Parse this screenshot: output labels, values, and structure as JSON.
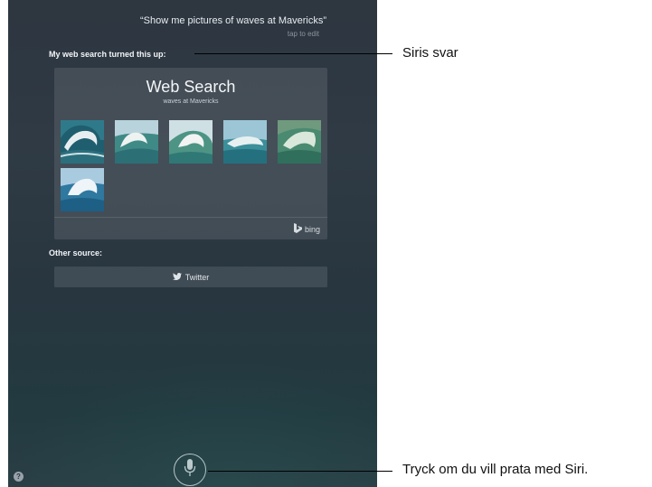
{
  "siri": {
    "query": "“Show me pictures of waves at Mavericks”",
    "tap_to_edit": "tap to edit",
    "response": "My web search turned this up:",
    "card": {
      "title": "Web Search",
      "subtitle": "waves at Mavericks",
      "thumbnails": [
        {
          "name": "wave-image-1"
        },
        {
          "name": "wave-image-2"
        },
        {
          "name": "wave-image-3"
        },
        {
          "name": "wave-image-4"
        },
        {
          "name": "wave-image-5"
        },
        {
          "name": "wave-image-6"
        }
      ],
      "provider": "bing",
      "provider_icon": "bing-logo-icon"
    },
    "other_source_label": "Other source:",
    "twitter_button": "Twitter",
    "twitter_icon": "twitter-bird-icon",
    "mic_icon": "microphone-icon",
    "help_icon_label": "?"
  },
  "callouts": {
    "response_label": "Siris svar",
    "mic_label": "Tryck om du vill prata med Siri."
  },
  "colors": {
    "background": "#2e3640",
    "card": "#ffffff1c",
    "text": "#f3f5f7",
    "muted": "#8b949d"
  }
}
